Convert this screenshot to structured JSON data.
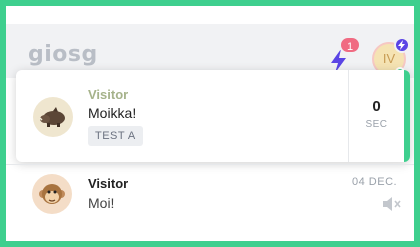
{
  "header": {
    "logo": "giosg",
    "notification_count": "1",
    "user_initials": "IV",
    "user_badge_icon": "bolt-icon"
  },
  "active_chat": {
    "name": "Visitor",
    "message": "Moikka!",
    "tag": "TEST A",
    "timer_value": "0",
    "timer_unit": "SEC",
    "avatar": "boar-avatar",
    "accent_color": "#3ecf8e"
  },
  "chat_list": [
    {
      "name": "Visitor",
      "message": "Moi!",
      "date": "04 DEC.",
      "avatar": "monkey-avatar",
      "status_icon": "muted-speaker-icon"
    }
  ],
  "colors": {
    "frame": "#3ecf8e",
    "badge": "#f06b82",
    "bolt": "#5a44e5"
  }
}
